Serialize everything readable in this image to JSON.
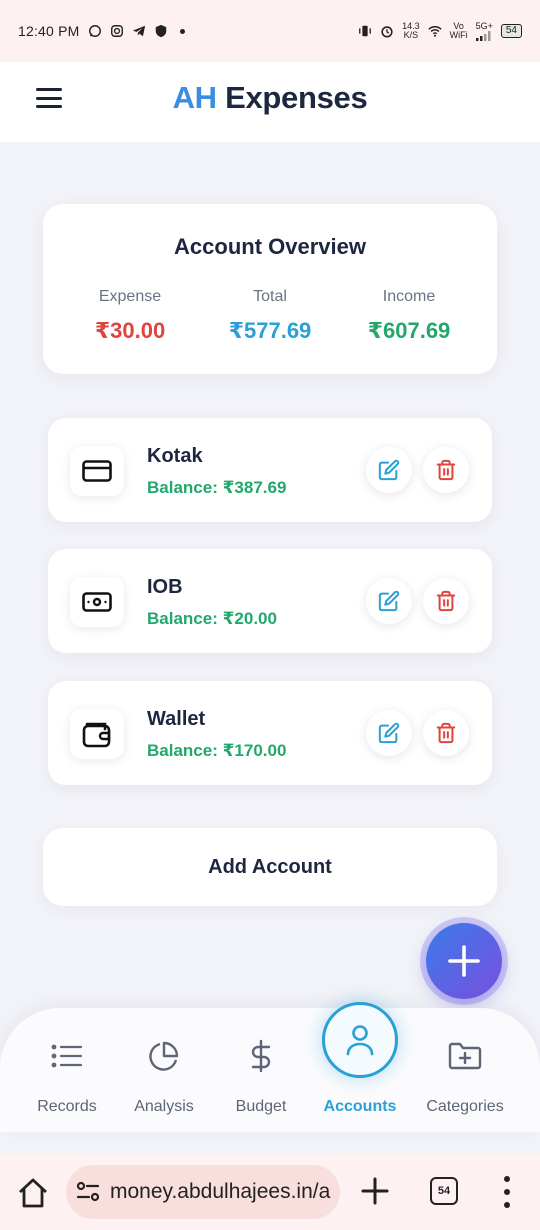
{
  "status_bar": {
    "time": "12:40 PM",
    "net_speed_value": "14.3",
    "net_speed_unit": "K/S",
    "vowifi_top": "Vo",
    "vowifi_bottom": "WiFi",
    "network": "5G+",
    "battery": "54"
  },
  "header": {
    "brand_prefix": "AH",
    "brand_suffix": "Expenses"
  },
  "overview": {
    "title": "Account Overview",
    "expense_label": "Expense",
    "expense_value": "₹30.00",
    "total_label": "Total",
    "total_value": "₹577.69",
    "income_label": "Income",
    "income_value": "₹607.69"
  },
  "accounts": [
    {
      "name": "Kotak",
      "balance": "Balance: ₹387.69",
      "icon": "credit-card-icon"
    },
    {
      "name": "IOB",
      "balance": "Balance: ₹20.00",
      "icon": "cash-icon"
    },
    {
      "name": "Wallet",
      "balance": "Balance: ₹170.00",
      "icon": "wallet-icon"
    }
  ],
  "add_account_label": "Add Account",
  "nav": {
    "items": [
      {
        "label": "Records",
        "icon": "list-icon"
      },
      {
        "label": "Analysis",
        "icon": "pie-chart-icon"
      },
      {
        "label": "Budget",
        "icon": "dollar-icon"
      },
      {
        "label": "Accounts",
        "icon": "user-icon"
      },
      {
        "label": "Categories",
        "icon": "folder-plus-icon"
      }
    ],
    "active": "Accounts"
  },
  "browser": {
    "url": "money.abdulhajees.in/a",
    "tab_count": "54"
  },
  "colors": {
    "expense": "#e0443e",
    "total": "#2aa0d6",
    "income": "#22a86b",
    "edit": "#2aa0d6",
    "delete": "#e0443e",
    "brand_accent": "#3a8de0"
  }
}
